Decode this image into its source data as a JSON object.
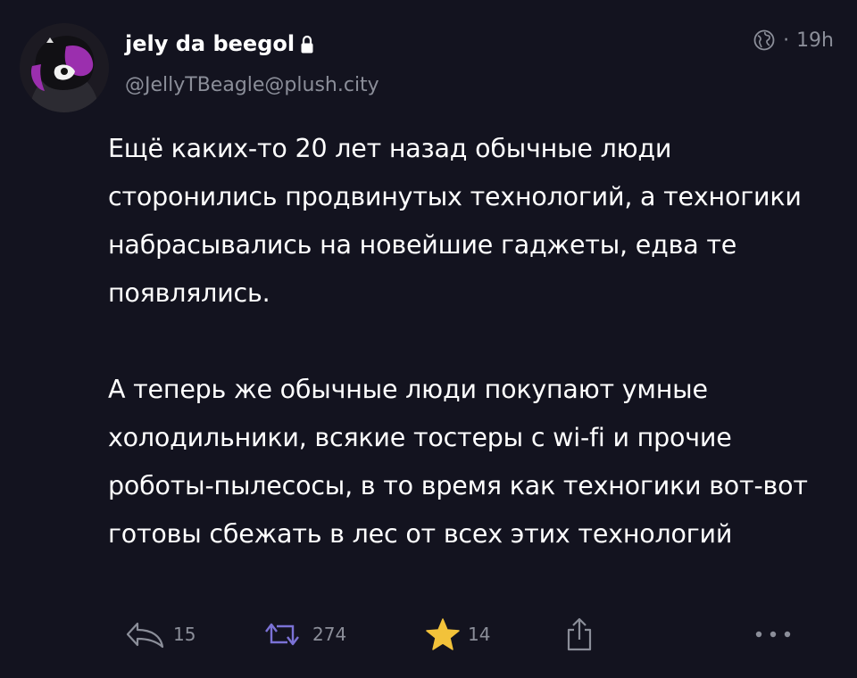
{
  "author": {
    "display_name": "jely da beegol",
    "handle": "@JellyTBeagle@plush.city",
    "locked": true
  },
  "meta": {
    "visibility_icon": "globe-icon",
    "separator": "·",
    "time": "19h"
  },
  "post": {
    "paragraphs": [
      "Ещё каких-то 20 лет назад обычные люди сторонились продвинутых технологий, а техногики набрасывались на новейшие гаджеты, едва те появлялись.",
      "А теперь же обычные люди покупают умные холодильники, всякие тостеры с wi-fi и прочие роботы-пылесосы, в то время как техногики вот-вот готовы сбежать в лес от всех этих технологий"
    ]
  },
  "actions": {
    "reply_count": "15",
    "repost_count": "274",
    "favourite_count": "14",
    "icons": [
      "reply-icon",
      "repost-icon",
      "star-icon",
      "share-icon",
      "more-icon"
    ]
  },
  "colors": {
    "background": "#13131f",
    "text": "#ffffff",
    "muted": "#8b8e99",
    "repost_accent": "#7b72d6",
    "star": "#f2c23a",
    "avatar_accent": "#9b2fae"
  }
}
